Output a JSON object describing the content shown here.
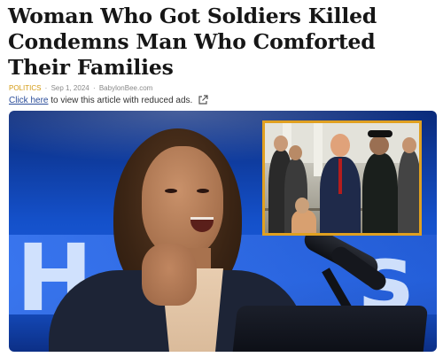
{
  "article": {
    "headline": "Woman Who Got Soldiers Killed Condemns Man Who Comforted Their Families",
    "category": "POLITICS",
    "date": "Sep 1, 2024",
    "source": "BabylonBee.com",
    "reduced_ads": {
      "link_text": "Click here",
      "text": "to view this article with reduced ads.",
      "icon": "external-link-icon"
    }
  },
  "hero": {
    "background_letters": "H    s",
    "inset_border_color": "#e0a020",
    "background_color": "#1450c9"
  }
}
